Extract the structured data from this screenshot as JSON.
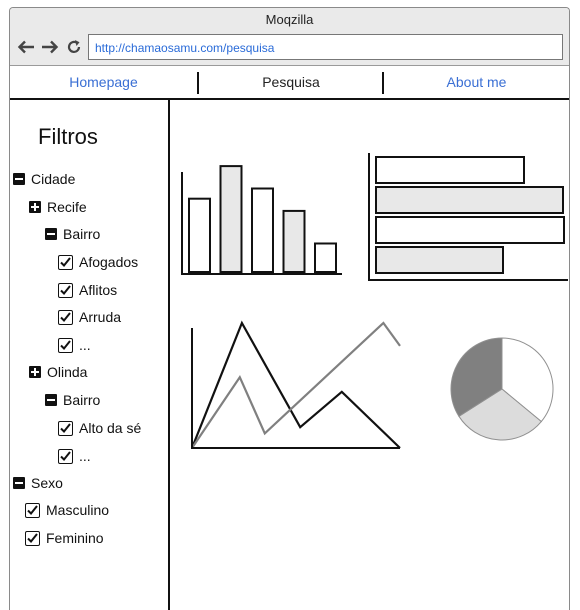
{
  "window": {
    "title": "Moqzilla"
  },
  "browser": {
    "url": "http://chamaosamu.com/pesquisa",
    "icons": [
      "back-arrow-icon",
      "forward-arrow-icon",
      "reload-icon"
    ]
  },
  "nav": {
    "tabs": [
      {
        "label": "Homepage"
      },
      {
        "label": "Pesquisa"
      },
      {
        "label": "About me"
      }
    ],
    "link_color": "#3a6fd4"
  },
  "sidebar": {
    "title": "Filtros",
    "tree": {
      "cidade": "Cidade",
      "recife": "Recife",
      "recife_bairro": "Bairro",
      "afogados": "Afogados",
      "aflitos": "Aflitos",
      "arruda": "Arruda",
      "recife_more": "...",
      "olinda": "Olinda",
      "olinda_bairro": "Bairro",
      "alto_da_se": "Alto da sé",
      "olinda_more": "...",
      "sexo": "Sexo",
      "masculino": "Masculino",
      "feminino": "Feminino"
    }
  },
  "chart_data": [
    {
      "type": "bar",
      "orientation": "vertical",
      "categories": [
        "",
        "",
        "",
        "",
        ""
      ],
      "values": [
        72,
        104,
        82,
        60,
        28
      ],
      "ylim": [
        0,
        110
      ],
      "fill": [
        "#ffffff",
        "#e8e8e8",
        "#ffffff",
        "#e8e8e8",
        "#ffffff"
      ],
      "title": "",
      "xlabel": "",
      "ylabel": ""
    },
    {
      "type": "bar",
      "orientation": "horizontal",
      "categories": [
        "",
        "",
        "",
        ""
      ],
      "values": [
        148,
        187,
        188,
        127
      ],
      "xlim": [
        0,
        195
      ],
      "fill": [
        "#ffffff",
        "#e8e8e8",
        "#ffffff",
        "#e8e8e8"
      ],
      "title": "",
      "xlabel": "",
      "ylabel": ""
    },
    {
      "type": "line",
      "x": [
        0,
        48,
        104,
        144,
        200
      ],
      "series": [
        {
          "values": [
            0,
            120,
            20,
            54,
            0
          ],
          "color": "#111111"
        },
        {
          "x": [
            0,
            46,
            70,
            184,
            200
          ],
          "values": [
            0,
            68,
            14,
            120,
            98
          ],
          "color": "#808080"
        }
      ],
      "xlim": [
        0,
        200
      ],
      "ylim": [
        0,
        120
      ],
      "title": "",
      "xlabel": "",
      "ylabel": ""
    },
    {
      "type": "pie",
      "values": [
        0.36,
        0.3,
        0.34
      ],
      "colors": [
        "#ffffff",
        "#dcdcdc",
        "#808080"
      ],
      "title": ""
    }
  ]
}
